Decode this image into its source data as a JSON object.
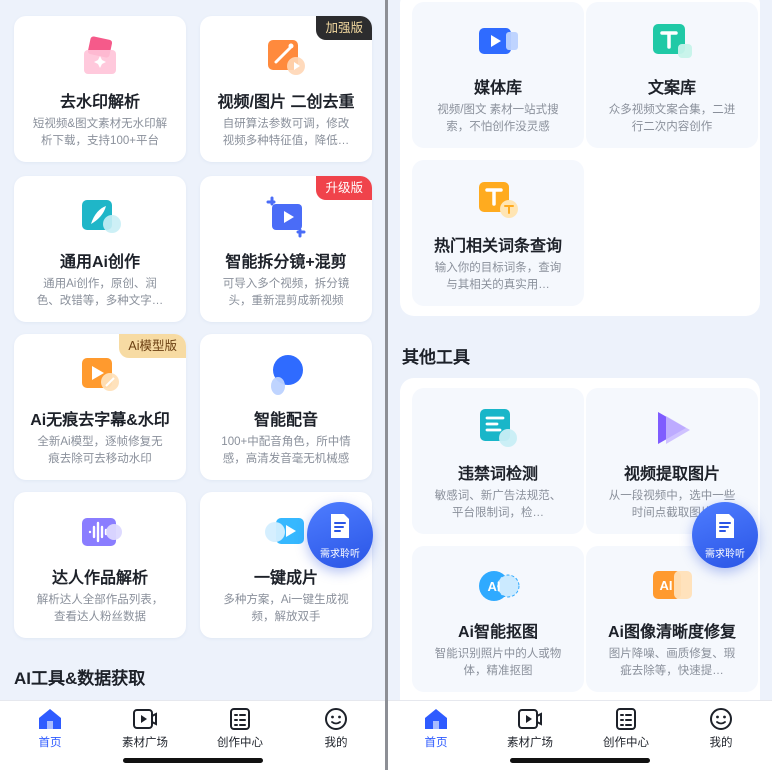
{
  "left_screen": {
    "cards": [
      {
        "title": "去水印解析",
        "desc": "短视频&图文素材无水印解析下载，支持100+平台",
        "icon": "eraser-icon",
        "tag": ""
      },
      {
        "title": "视频/图片 二创去重",
        "desc": "自研算法参数可调，修改视频多种特征值，降低…",
        "icon": "magic-wand-video-icon",
        "tag": "加强版"
      },
      {
        "title": "通用Ai创作",
        "desc": "通用Ai创作，原创、润色、改错等，多种文字…",
        "icon": "quill-icon",
        "tag": ""
      },
      {
        "title": "智能拆分镜+混剪",
        "desc": "可导入多个视频，拆分镜头，重新混剪成新视频",
        "icon": "crop-video-icon",
        "tag": "升级版"
      },
      {
        "title": "Ai无痕去字幕&水印",
        "desc": "全新Ai模型，逐帧修复无痕去除可去移动水印",
        "icon": "subtitle-remove-icon",
        "tag": "Ai模型版"
      },
      {
        "title": "智能配音",
        "desc": "100+中配音角色，所中情感，高清发音毫无机械感",
        "icon": "microphone-icon",
        "tag": ""
      },
      {
        "title": "达人作品解析",
        "desc": "解析达人全部作品列表，查看达人粉丝数据",
        "icon": "sound-wave-icon",
        "tag": ""
      },
      {
        "title": "一键成片",
        "desc": "多种方案，Ai一键生成视频，解放双手",
        "icon": "text-to-video-icon",
        "tag": ""
      }
    ],
    "section_title": "AI工具&数据获取",
    "fab_label": "需求聆听"
  },
  "right_screen": {
    "cards_top": [
      {
        "title": "媒体库",
        "desc": "视频/图文 素材一站式搜索，不怕创作没灵感",
        "icon": "media-library-icon"
      },
      {
        "title": "文案库",
        "desc": "众多视频文案合集，二进行二次内容创作",
        "icon": "copy-library-icon"
      },
      {
        "title": "热门相关词条查询",
        "desc": "输入你的目标词条，查询与其相关的真实用…",
        "icon": "keyword-search-icon"
      }
    ],
    "section_title": "其他工具",
    "cards_bottom": [
      {
        "title": "违禁词检测",
        "desc": "敏感词、新广告法规范、平台限制词，检…",
        "icon": "forbidden-word-icon"
      },
      {
        "title": "视频提取图片",
        "desc": "从一段视频中，选中一些时间点截取图片",
        "icon": "video-extract-icon"
      },
      {
        "title": "Ai智能抠图",
        "desc": "智能识别照片中的人或物体，精准抠图",
        "icon": "ai-cutout-icon",
        "icon_text": "AI"
      },
      {
        "title": "Ai图像清晰度修复",
        "desc": "图片降噪、画质修复、瑕疵去除等，快速提…",
        "icon": "ai-enhance-icon",
        "icon_text": "AI"
      }
    ],
    "fab_label": "需求聆听"
  },
  "tabbar": {
    "tabs": [
      {
        "label": "首页",
        "icon": "home-icon",
        "active": true
      },
      {
        "label": "素材广场",
        "icon": "video-square-icon",
        "active": false
      },
      {
        "label": "创作中心",
        "icon": "checklist-icon",
        "active": false
      },
      {
        "label": "我的",
        "icon": "smiley-icon",
        "active": false
      }
    ]
  },
  "colors": {
    "accent": "#2e5bff",
    "background": "#edf2fb",
    "tag_red": "#f0434b",
    "tag_dark": "#2c2c2e",
    "tag_gold": "#f7dba3"
  }
}
